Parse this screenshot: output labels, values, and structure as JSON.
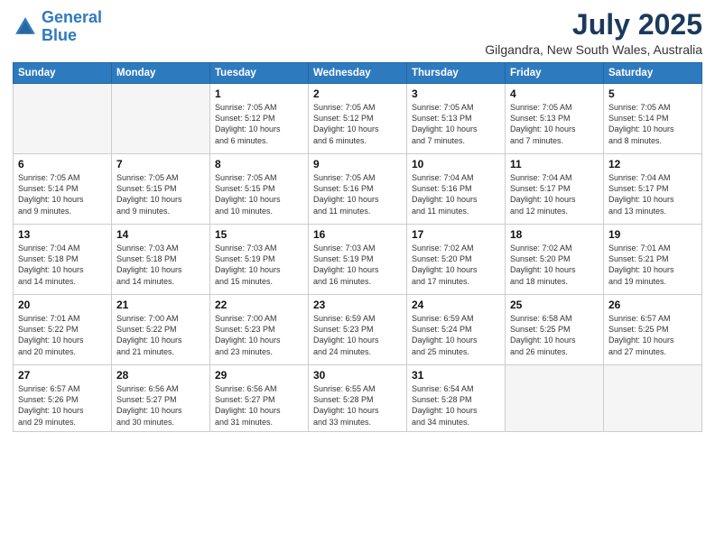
{
  "logo": {
    "line1": "General",
    "line2": "Blue"
  },
  "title": "July 2025",
  "subtitle": "Gilgandra, New South Wales, Australia",
  "headers": [
    "Sunday",
    "Monday",
    "Tuesday",
    "Wednesday",
    "Thursday",
    "Friday",
    "Saturday"
  ],
  "weeks": [
    [
      {
        "day": "",
        "info": ""
      },
      {
        "day": "",
        "info": ""
      },
      {
        "day": "1",
        "info": "Sunrise: 7:05 AM\nSunset: 5:12 PM\nDaylight: 10 hours\nand 6 minutes."
      },
      {
        "day": "2",
        "info": "Sunrise: 7:05 AM\nSunset: 5:12 PM\nDaylight: 10 hours\nand 6 minutes."
      },
      {
        "day": "3",
        "info": "Sunrise: 7:05 AM\nSunset: 5:13 PM\nDaylight: 10 hours\nand 7 minutes."
      },
      {
        "day": "4",
        "info": "Sunrise: 7:05 AM\nSunset: 5:13 PM\nDaylight: 10 hours\nand 7 minutes."
      },
      {
        "day": "5",
        "info": "Sunrise: 7:05 AM\nSunset: 5:14 PM\nDaylight: 10 hours\nand 8 minutes."
      }
    ],
    [
      {
        "day": "6",
        "info": "Sunrise: 7:05 AM\nSunset: 5:14 PM\nDaylight: 10 hours\nand 9 minutes."
      },
      {
        "day": "7",
        "info": "Sunrise: 7:05 AM\nSunset: 5:15 PM\nDaylight: 10 hours\nand 9 minutes."
      },
      {
        "day": "8",
        "info": "Sunrise: 7:05 AM\nSunset: 5:15 PM\nDaylight: 10 hours\nand 10 minutes."
      },
      {
        "day": "9",
        "info": "Sunrise: 7:05 AM\nSunset: 5:16 PM\nDaylight: 10 hours\nand 11 minutes."
      },
      {
        "day": "10",
        "info": "Sunrise: 7:04 AM\nSunset: 5:16 PM\nDaylight: 10 hours\nand 11 minutes."
      },
      {
        "day": "11",
        "info": "Sunrise: 7:04 AM\nSunset: 5:17 PM\nDaylight: 10 hours\nand 12 minutes."
      },
      {
        "day": "12",
        "info": "Sunrise: 7:04 AM\nSunset: 5:17 PM\nDaylight: 10 hours\nand 13 minutes."
      }
    ],
    [
      {
        "day": "13",
        "info": "Sunrise: 7:04 AM\nSunset: 5:18 PM\nDaylight: 10 hours\nand 14 minutes."
      },
      {
        "day": "14",
        "info": "Sunrise: 7:03 AM\nSunset: 5:18 PM\nDaylight: 10 hours\nand 14 minutes."
      },
      {
        "day": "15",
        "info": "Sunrise: 7:03 AM\nSunset: 5:19 PM\nDaylight: 10 hours\nand 15 minutes."
      },
      {
        "day": "16",
        "info": "Sunrise: 7:03 AM\nSunset: 5:19 PM\nDaylight: 10 hours\nand 16 minutes."
      },
      {
        "day": "17",
        "info": "Sunrise: 7:02 AM\nSunset: 5:20 PM\nDaylight: 10 hours\nand 17 minutes."
      },
      {
        "day": "18",
        "info": "Sunrise: 7:02 AM\nSunset: 5:20 PM\nDaylight: 10 hours\nand 18 minutes."
      },
      {
        "day": "19",
        "info": "Sunrise: 7:01 AM\nSunset: 5:21 PM\nDaylight: 10 hours\nand 19 minutes."
      }
    ],
    [
      {
        "day": "20",
        "info": "Sunrise: 7:01 AM\nSunset: 5:22 PM\nDaylight: 10 hours\nand 20 minutes."
      },
      {
        "day": "21",
        "info": "Sunrise: 7:00 AM\nSunset: 5:22 PM\nDaylight: 10 hours\nand 21 minutes."
      },
      {
        "day": "22",
        "info": "Sunrise: 7:00 AM\nSunset: 5:23 PM\nDaylight: 10 hours\nand 23 minutes."
      },
      {
        "day": "23",
        "info": "Sunrise: 6:59 AM\nSunset: 5:23 PM\nDaylight: 10 hours\nand 24 minutes."
      },
      {
        "day": "24",
        "info": "Sunrise: 6:59 AM\nSunset: 5:24 PM\nDaylight: 10 hours\nand 25 minutes."
      },
      {
        "day": "25",
        "info": "Sunrise: 6:58 AM\nSunset: 5:25 PM\nDaylight: 10 hours\nand 26 minutes."
      },
      {
        "day": "26",
        "info": "Sunrise: 6:57 AM\nSunset: 5:25 PM\nDaylight: 10 hours\nand 27 minutes."
      }
    ],
    [
      {
        "day": "27",
        "info": "Sunrise: 6:57 AM\nSunset: 5:26 PM\nDaylight: 10 hours\nand 29 minutes."
      },
      {
        "day": "28",
        "info": "Sunrise: 6:56 AM\nSunset: 5:27 PM\nDaylight: 10 hours\nand 30 minutes."
      },
      {
        "day": "29",
        "info": "Sunrise: 6:56 AM\nSunset: 5:27 PM\nDaylight: 10 hours\nand 31 minutes."
      },
      {
        "day": "30",
        "info": "Sunrise: 6:55 AM\nSunset: 5:28 PM\nDaylight: 10 hours\nand 33 minutes."
      },
      {
        "day": "31",
        "info": "Sunrise: 6:54 AM\nSunset: 5:28 PM\nDaylight: 10 hours\nand 34 minutes."
      },
      {
        "day": "",
        "info": ""
      },
      {
        "day": "",
        "info": ""
      }
    ]
  ]
}
